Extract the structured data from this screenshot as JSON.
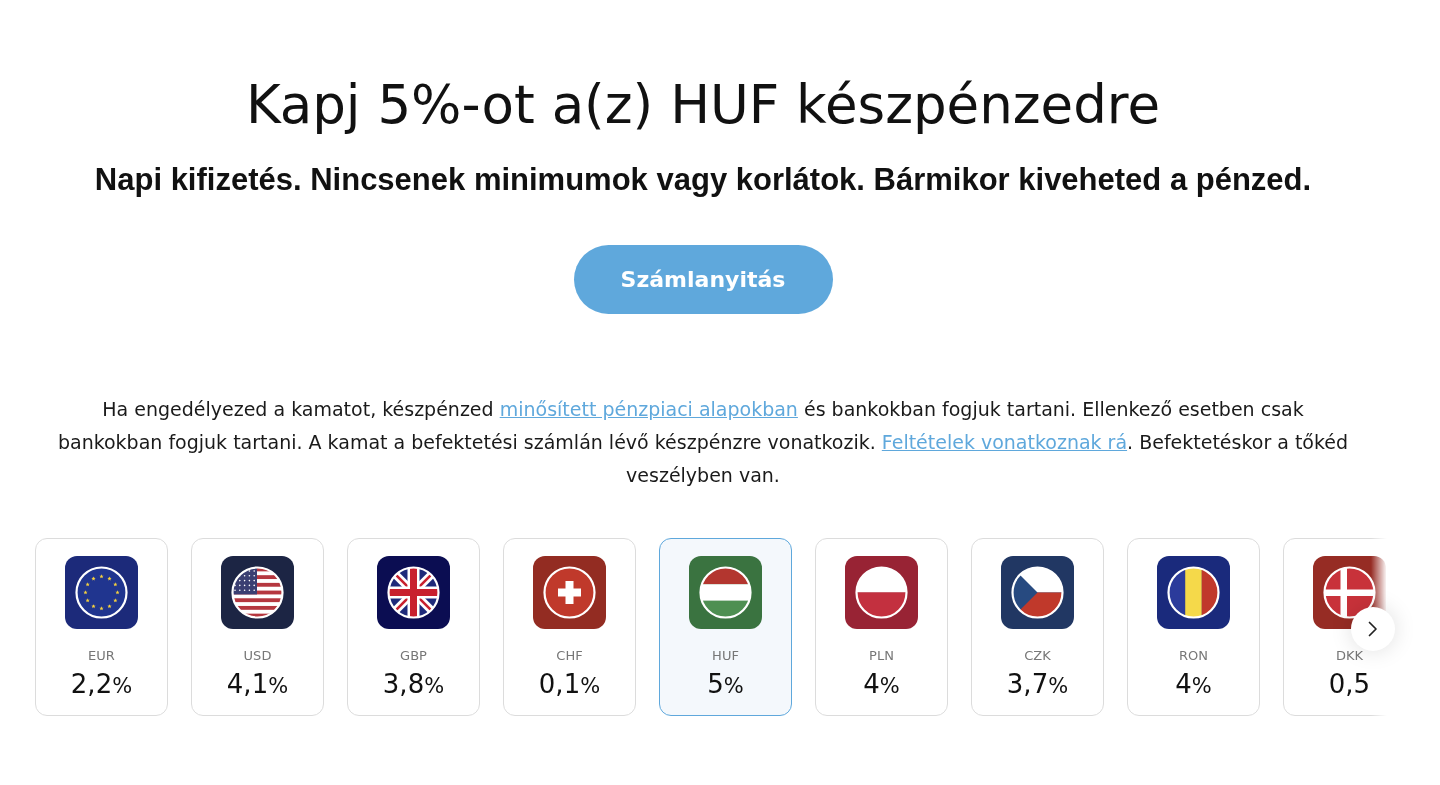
{
  "heading": "Kapj 5%-ot a(z) HUF készpénzedre",
  "subheading": "Napi kifizetés. Nincsenek minimumok vagy korlátok. Bármikor kiveheted a pénzed.",
  "cta_button": "Számlanyitás",
  "disclaimer": [
    {
      "kind": "text",
      "text": "Ha engedélyezed a kamatot, készpénzed "
    },
    {
      "kind": "link",
      "text": "minősített pénzpiaci alapokban"
    },
    {
      "kind": "text",
      "text": " és bankokban fogjuk tartani. Ellenkező esetben csak bankokban fogjuk tartani. A kamat a befektetési számlán lévő készpénzre vonatkozik. "
    },
    {
      "kind": "link",
      "text": "Feltételek vonatkoznak rá"
    },
    {
      "kind": "text",
      "text": ". Befektetéskor a tőkéd veszélyben van."
    }
  ],
  "currencies": [
    {
      "kind": "eu",
      "code": "EUR",
      "rate": "2,2",
      "unit": "%",
      "selected": false
    },
    {
      "kind": "us",
      "code": "USD",
      "rate": "4,1",
      "unit": "%",
      "selected": false
    },
    {
      "kind": "gb",
      "code": "GBP",
      "rate": "3,8",
      "unit": "%",
      "selected": false
    },
    {
      "kind": "ch",
      "code": "CHF",
      "rate": "0,1",
      "unit": "%",
      "selected": false
    },
    {
      "kind": "hu",
      "code": "HUF",
      "rate": "5",
      "unit": "%",
      "selected": true
    },
    {
      "kind": "pl",
      "code": "PLN",
      "rate": "4",
      "unit": "%",
      "selected": false
    },
    {
      "kind": "cz",
      "code": "CZK",
      "rate": "3,7",
      "unit": "%",
      "selected": false
    },
    {
      "kind": "ro",
      "code": "RON",
      "rate": "4",
      "unit": "%",
      "selected": false
    },
    {
      "kind": "dk",
      "code": "DKK",
      "rate": "0,5",
      "selected": false
    }
  ]
}
